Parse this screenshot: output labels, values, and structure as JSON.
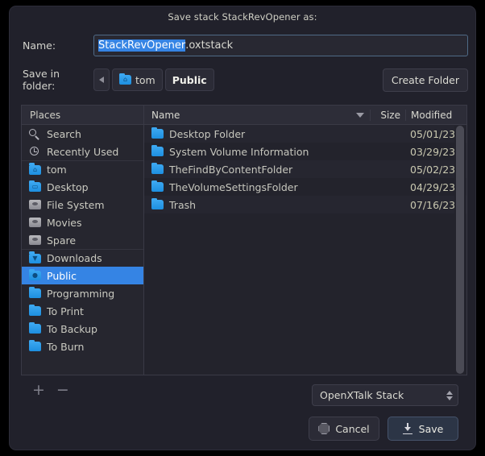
{
  "window": {
    "title": "Save stack StackRevOpener as:"
  },
  "name_field": {
    "label": "Name:",
    "selected_text": "StackRevOpener",
    "rest_text": ".oxtstack",
    "value": "StackRevOpener.oxtstack"
  },
  "folder_field": {
    "label": "Save in folder:",
    "back_label": "",
    "crumbs": [
      {
        "label": "tom",
        "icon": "home-folder-icon",
        "current": false
      },
      {
        "label": "Public",
        "icon": "",
        "current": true
      }
    ],
    "create_folder_label": "Create Folder"
  },
  "places": {
    "header": "Places",
    "items": [
      {
        "label": "Search",
        "icon": "search-icon",
        "type": "search",
        "selected": false,
        "sep": false
      },
      {
        "label": "Recently Used",
        "icon": "clock-icon",
        "type": "clock",
        "selected": false,
        "sep": false
      },
      {
        "label": "tom",
        "icon": "home-folder-icon",
        "type": "folder",
        "glyph": "⌂",
        "selected": false,
        "sep": true
      },
      {
        "label": "Desktop",
        "icon": "desktop-folder-icon",
        "type": "folder",
        "glyph": "▭",
        "selected": false,
        "sep": false
      },
      {
        "label": "File System",
        "icon": "drive-icon",
        "type": "drive",
        "selected": false,
        "sep": false
      },
      {
        "label": "Movies",
        "icon": "drive-icon",
        "type": "drive",
        "selected": false,
        "sep": false
      },
      {
        "label": "Spare",
        "icon": "drive-icon",
        "type": "drive",
        "selected": false,
        "sep": false
      },
      {
        "label": "Downloads",
        "icon": "downloads-folder-icon",
        "type": "folder",
        "glyph": "▼",
        "selected": false,
        "sep": true
      },
      {
        "label": "Public",
        "icon": "public-folder-icon",
        "type": "folder",
        "glyph": "●",
        "selected": true,
        "sep": false
      },
      {
        "label": "Programming",
        "icon": "folder-icon",
        "type": "folder",
        "glyph": "",
        "selected": false,
        "sep": false
      },
      {
        "label": "To Print",
        "icon": "folder-icon",
        "type": "folder",
        "glyph": "",
        "selected": false,
        "sep": false
      },
      {
        "label": "To Backup",
        "icon": "folder-icon",
        "type": "folder",
        "glyph": "",
        "selected": false,
        "sep": false
      },
      {
        "label": "To Burn",
        "icon": "folder-icon",
        "type": "folder",
        "glyph": "",
        "selected": false,
        "sep": false
      }
    ],
    "add_label": "+",
    "remove_label": "−"
  },
  "file_list": {
    "columns": {
      "name": "Name",
      "size": "Size",
      "modified": "Modified"
    },
    "sort_indicator": "descending-sort-icon",
    "rows": [
      {
        "name": "Desktop Folder",
        "size": "",
        "modified": "05/01/23"
      },
      {
        "name": "System Volume Information",
        "size": "",
        "modified": "03/29/23"
      },
      {
        "name": "TheFindByContentFolder",
        "size": "",
        "modified": "05/02/23"
      },
      {
        "name": "TheVolumeSettingsFolder",
        "size": "",
        "modified": "04/29/23"
      },
      {
        "name": "Trash",
        "size": "",
        "modified": "07/16/23"
      }
    ]
  },
  "filter": {
    "value": "OpenXTalk Stack"
  },
  "buttons": {
    "cancel": "Cancel",
    "save": "Save"
  },
  "colors": {
    "accent": "#3584e4",
    "window_bg": "#21212b",
    "pane_bg": "#23232c",
    "folder_blue": "#2d9bea"
  }
}
